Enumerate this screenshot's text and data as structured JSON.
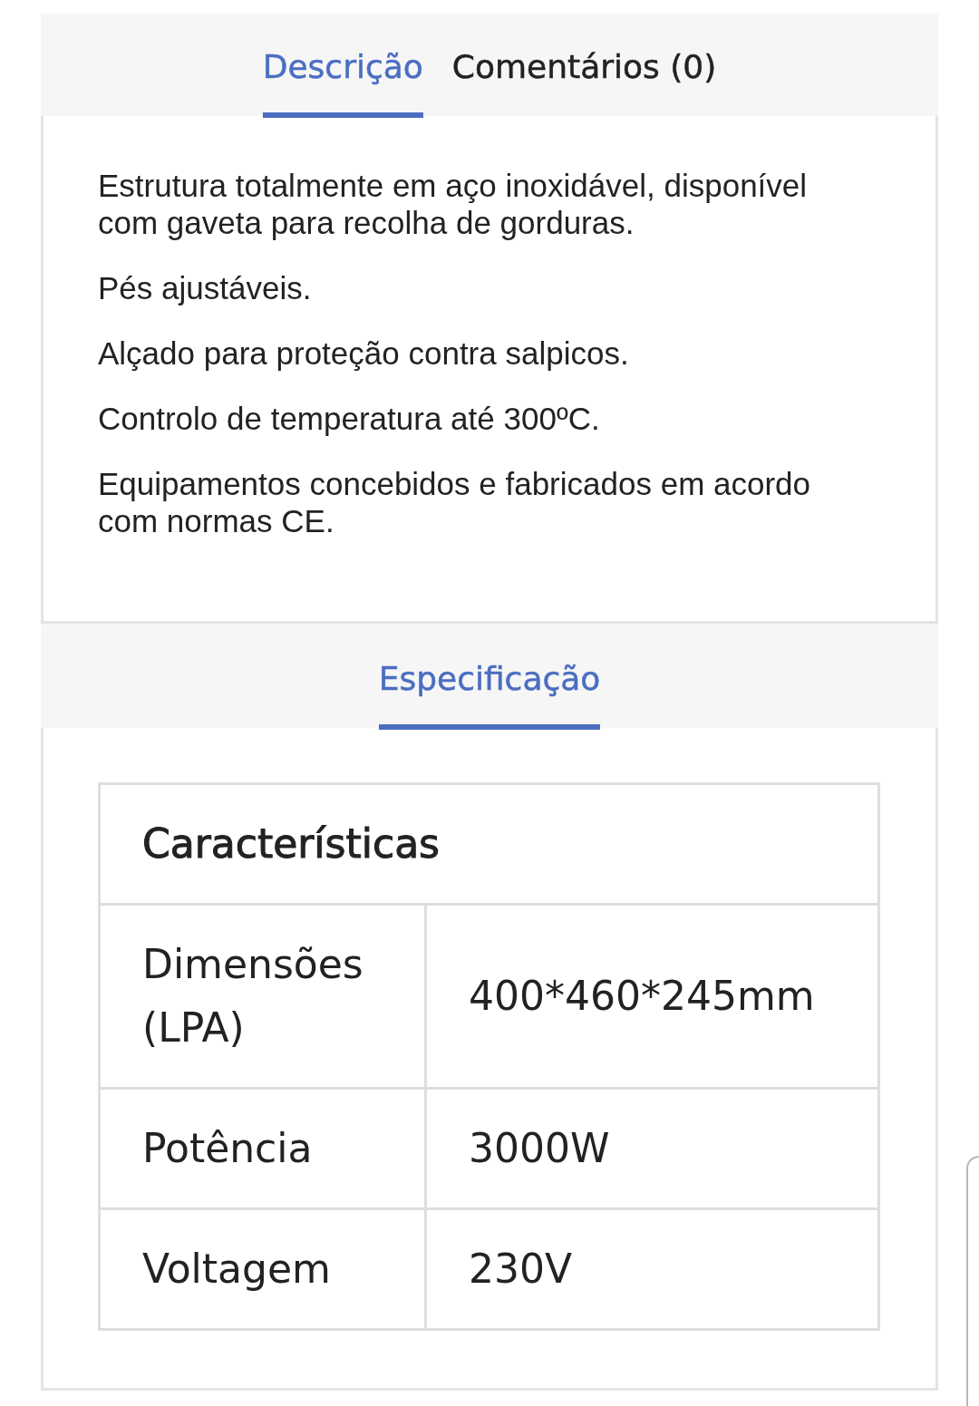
{
  "tabs": [
    {
      "label": "Descrição",
      "selected": true
    },
    {
      "label": "Comentários (0)",
      "selected": false
    }
  ],
  "description": {
    "paragraphs": [
      "Estrutura totalmente em aço inoxidável, disponível com gaveta para recolha de gorduras.",
      "Pés ajustáveis.",
      "Alçado para proteção contra salpicos.",
      "Controlo de temperatura até 300ºC.",
      "Equipamentos concebidos e fabricados em acordo com normas CE."
    ]
  },
  "spec_tabs": [
    {
      "label": "Especificação",
      "selected": true
    }
  ],
  "spec_table": {
    "title": "Características",
    "rows": [
      {
        "label": "Dimensões (LPA)",
        "value": "400*460*245mm"
      },
      {
        "label": "Potência",
        "value": "3000W"
      },
      {
        "label": "Voltagem",
        "value": "230V"
      }
    ]
  }
}
